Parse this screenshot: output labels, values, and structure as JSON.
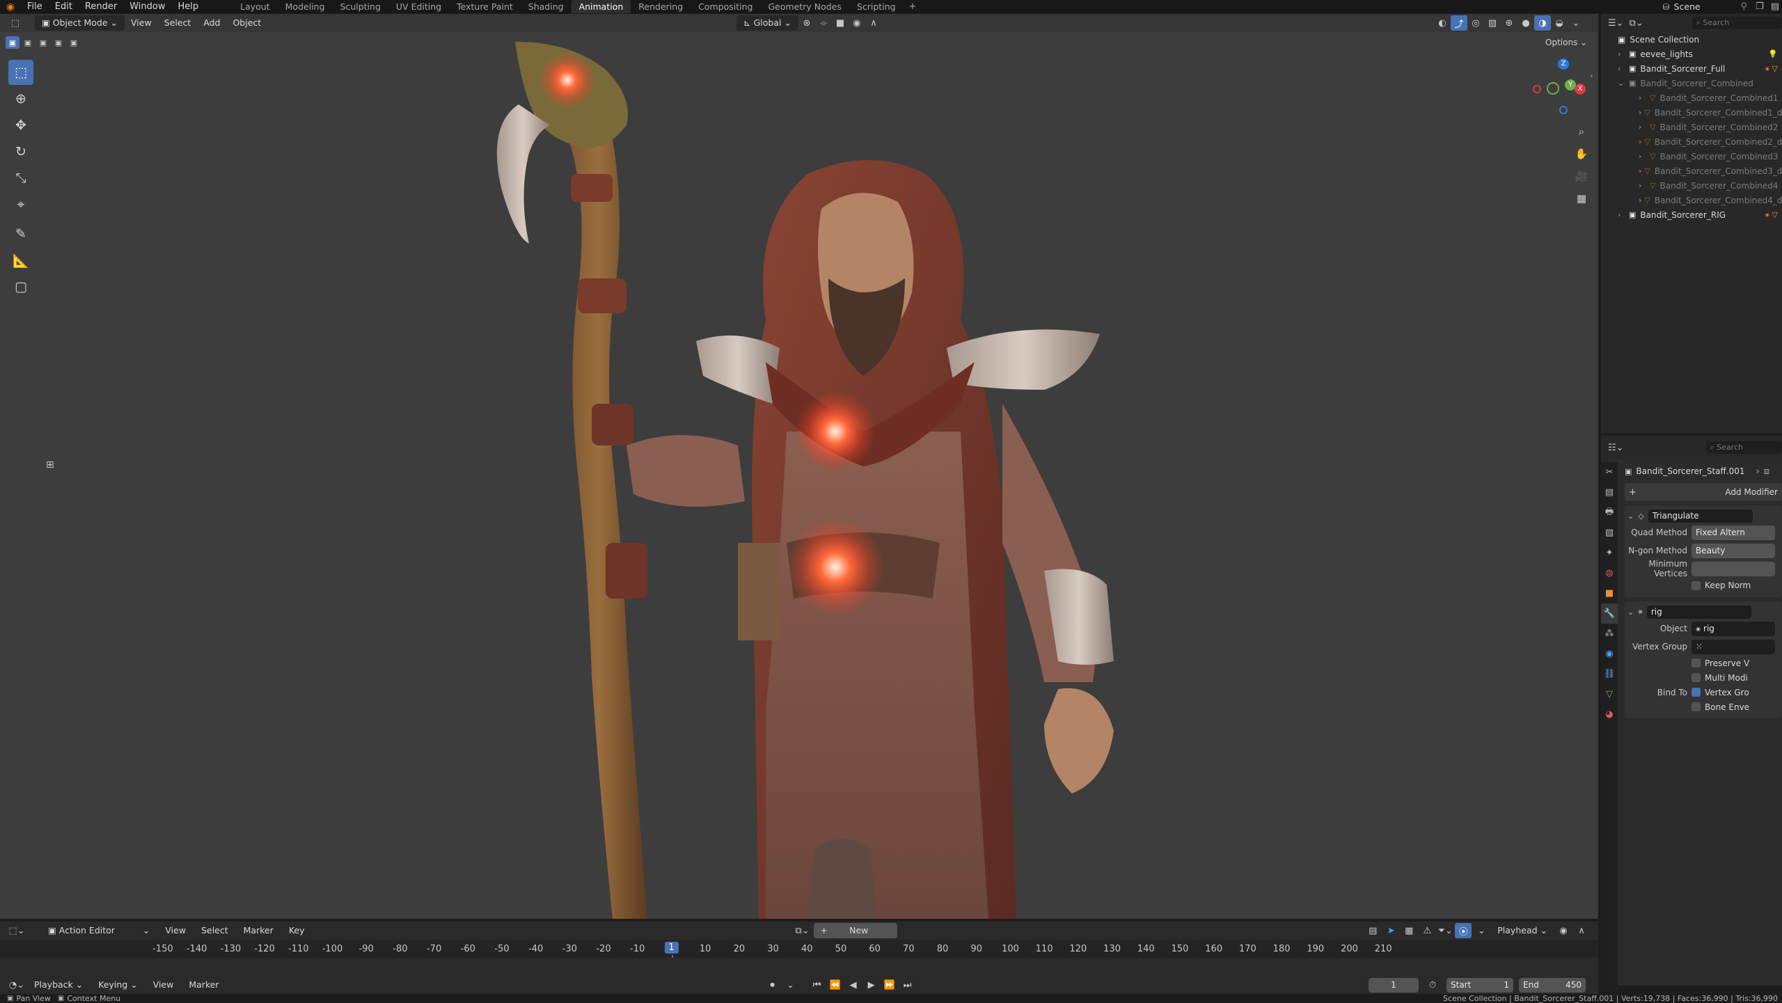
{
  "menu": {
    "file": "File",
    "edit": "Edit",
    "render": "Render",
    "window": "Window",
    "help": "Help"
  },
  "workspaces": [
    "Layout",
    "Modeling",
    "Sculpting",
    "UV Editing",
    "Texture Paint",
    "Shading",
    "Animation",
    "Rendering",
    "Compositing",
    "Geometry Nodes",
    "Scripting"
  ],
  "active_workspace": "Animation",
  "scene": {
    "label": "Scene"
  },
  "viewport": {
    "mode": "Object Mode",
    "view": "View",
    "select": "Select",
    "add": "Add",
    "object": "Object",
    "orientation": "Global",
    "options": "Options"
  },
  "gizmo": {
    "x": "X",
    "y": "Y",
    "z": "Z"
  },
  "outliner": {
    "search_placeholder": "Search",
    "root": "Scene Collection",
    "items": [
      {
        "label": "eevee_lights",
        "dim": false
      },
      {
        "label": "Bandit_Sorcerer_Full",
        "dim": false
      },
      {
        "label": "Bandit_Sorcerer_Combined",
        "dim": true
      },
      {
        "label": "Bandit_Sorcerer_Combined1",
        "dim": true
      },
      {
        "label": "Bandit_Sorcerer_Combined1_d",
        "dim": true
      },
      {
        "label": "Bandit_Sorcerer_Combined2",
        "dim": true
      },
      {
        "label": "Bandit_Sorcerer_Combined2_d",
        "dim": true
      },
      {
        "label": "Bandit_Sorcerer_Combined3",
        "dim": true
      },
      {
        "label": "Bandit_Sorcerer_Combined3_d",
        "dim": true
      },
      {
        "label": "Bandit_Sorcerer_Combined4",
        "dim": true
      },
      {
        "label": "Bandit_Sorcerer_Combined4_d",
        "dim": true
      },
      {
        "label": "Bandit_Sorcerer_RIG",
        "dim": false
      }
    ]
  },
  "properties": {
    "search_placeholder": "Search",
    "object_name": "Bandit_Sorcerer_Staff.001",
    "add_modifier": "Add Modifier",
    "triangulate": {
      "name": "Triangulate",
      "quad_method_label": "Quad Method",
      "quad_method": "Fixed Altern",
      "ngon_label": "N-gon Method",
      "ngon": "Beauty",
      "min_vertices_label": "Minimum Vertices",
      "keep_normals": "Keep Norm"
    },
    "armature": {
      "name": "rig",
      "object_label": "Object",
      "object": "rig",
      "vertex_group_label": "Vertex Group",
      "preserve": "Preserve V",
      "multi": "Multi Modi",
      "bind_to_label": "Bind To",
      "vertex_groups": "Vertex Gro",
      "bone_envelopes": "Bone Enve"
    }
  },
  "timeline": {
    "editor": "Action Editor",
    "view": "View",
    "select": "Select",
    "marker": "Marker",
    "key": "Key",
    "new": "New",
    "playhead": "Playhead",
    "ticks": [
      "-150",
      "-140",
      "-130",
      "-120",
      "-110",
      "-100",
      "-90",
      "-80",
      "-70",
      "-60",
      "-50",
      "-40",
      "-30",
      "-20",
      "-10",
      "1",
      "10",
      "20",
      "30",
      "40",
      "50",
      "60",
      "70",
      "80",
      "90",
      "100",
      "110",
      "120",
      "130",
      "140",
      "150",
      "160",
      "170",
      "180",
      "190",
      "200",
      "210"
    ],
    "current_frame": "1",
    "playback": "Playback",
    "keying": "Keying",
    "view2": "View",
    "marker2": "Marker",
    "frame": "1",
    "start_label": "Start",
    "start": "1",
    "end_label": "End",
    "end": "450"
  },
  "status": {
    "pan": "Pan View",
    "context": "Context Menu",
    "info": "Scene Collection | Bandit_Sorcerer_Staff.001 | Verts:19,738 | Faces:36,990 | Tris:36,990"
  },
  "colors": {
    "accent": "#4772b3",
    "orb": "#ff5a3c",
    "robe": "#7a3a2c",
    "bg": "#3d3d3d"
  }
}
